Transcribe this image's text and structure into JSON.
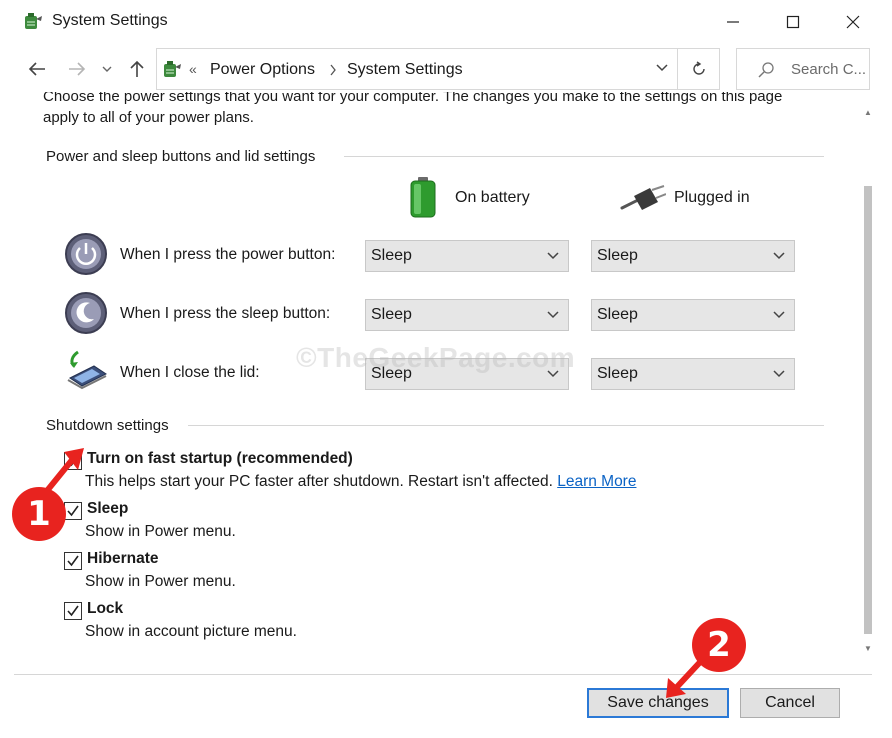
{
  "window": {
    "title": "System Settings",
    "icon": "power-options-icon"
  },
  "nav": {
    "back_icon": "arrow-left-icon",
    "forward_icon": "arrow-right-icon",
    "recent_icon": "chevron-down-icon",
    "up_icon": "arrow-up-icon",
    "breadcrumb_prefix": "«",
    "breadcrumb": [
      "Power Options",
      "System Settings"
    ],
    "search_placeholder": "Search C..."
  },
  "intro": "Choose the power settings that you want for your computer. The changes you make to the settings on this page apply to all of your power plans.",
  "power_section": {
    "heading": "Power and sleep buttons and lid settings",
    "columns": {
      "battery": "On battery",
      "plugged": "Plugged in"
    },
    "rows": [
      {
        "label": "When I press the power button:",
        "icon": "power-button-icon",
        "battery": "Sleep",
        "plugged": "Sleep"
      },
      {
        "label": "When I press the sleep button:",
        "icon": "sleep-button-icon",
        "battery": "Sleep",
        "plugged": "Sleep"
      },
      {
        "label": "When I close the lid:",
        "icon": "laptop-lid-icon",
        "battery": "Sleep",
        "plugged": "Sleep"
      }
    ]
  },
  "shutdown_section": {
    "heading": "Shutdown settings",
    "items": [
      {
        "title": "Turn on fast startup (recommended)",
        "desc": "This helps start your PC faster after shutdown. Restart isn't affected.",
        "link": "Learn More",
        "checked": true
      },
      {
        "title": "Sleep",
        "desc": "Show in Power menu.",
        "checked": true
      },
      {
        "title": "Hibernate",
        "desc": "Show in Power menu.",
        "checked": true
      },
      {
        "title": "Lock",
        "desc": "Show in account picture menu.",
        "checked": true
      }
    ]
  },
  "watermark": "©TheGeekPage.com",
  "buttons": {
    "save": "Save changes",
    "cancel": "Cancel"
  },
  "annotations": {
    "step1": "1",
    "step2": "2",
    "color": "#e8231f"
  }
}
